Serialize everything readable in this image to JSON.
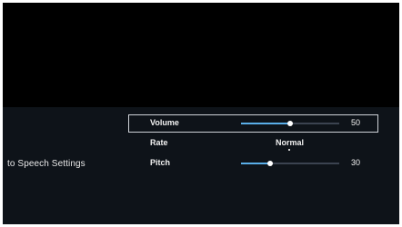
{
  "menu": {
    "section_title": "to Speech Settings"
  },
  "settings": {
    "volume": {
      "label": "Volume",
      "value": "50",
      "level": 0.5
    },
    "rate": {
      "label": "Rate",
      "value": "Normal"
    },
    "pitch": {
      "label": "Pitch",
      "value": "30",
      "level": 0.3
    }
  },
  "colors": {
    "slider_fill": "#5aaee8",
    "focus_border": "#cfd3d8"
  }
}
